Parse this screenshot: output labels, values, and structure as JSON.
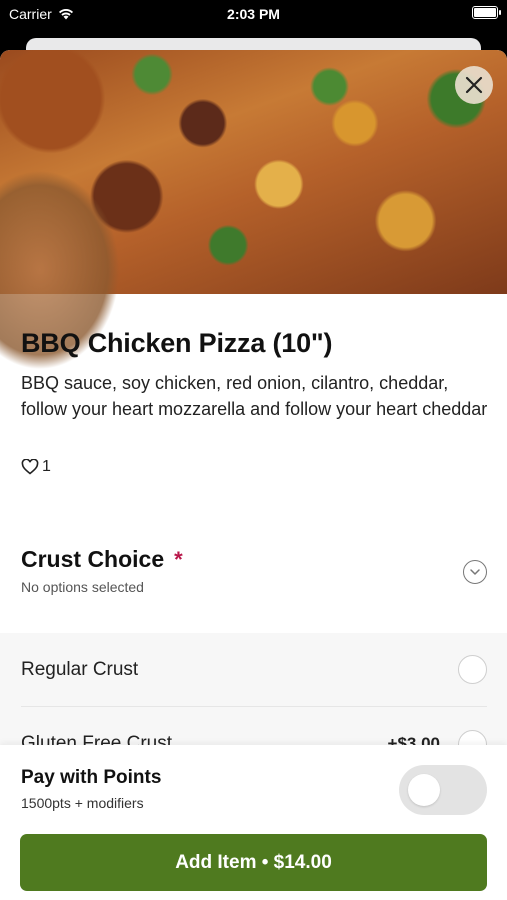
{
  "status_bar": {
    "carrier": "Carrier",
    "time": "2:03 PM"
  },
  "item": {
    "title": "BBQ Chicken Pizza (10\")",
    "description": "BBQ sauce, soy chicken, red onion, cilantro, cheddar, follow your heart mozzarella and follow your heart cheddar",
    "likes": "1"
  },
  "crust_section": {
    "title": "Crust Choice",
    "required_mark": "*",
    "subtitle": "No options selected",
    "options": [
      {
        "label": "Regular Crust",
        "price": ""
      },
      {
        "label": "Gluten Free Crust",
        "price": "+$3.00"
      }
    ]
  },
  "points": {
    "title": "Pay with Points",
    "subtitle": "1500pts + modifiers",
    "enabled": false
  },
  "cta": {
    "label": "Add Item • $14.00"
  },
  "colors": {
    "accent_green": "#4f7a1f",
    "required_red": "#b8174a"
  }
}
